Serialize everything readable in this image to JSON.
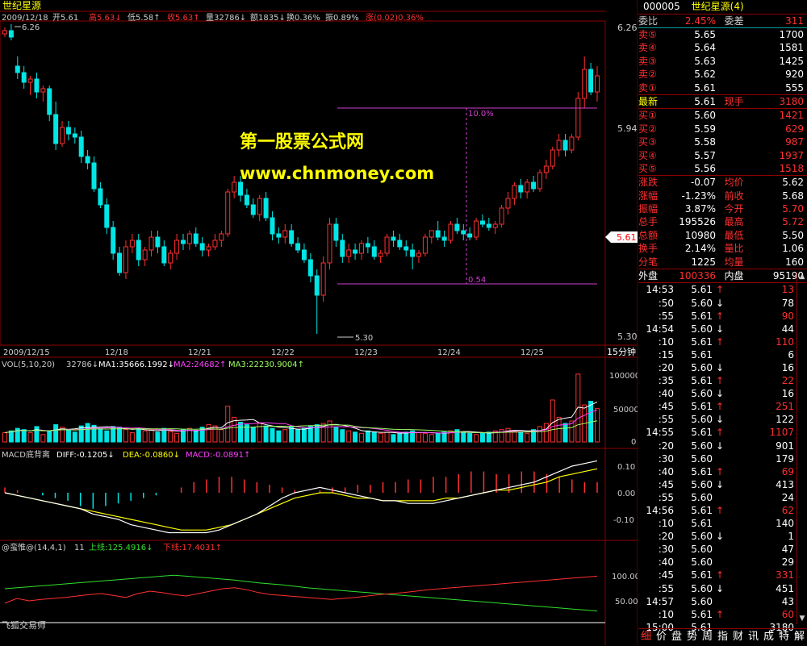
{
  "colors": {
    "up": "#ff3030",
    "down": "#00e5e5",
    "ma1": "#ffffff",
    "ma2": "#ff40ff",
    "ma3": "#a0ff60",
    "grid": "#900000",
    "label": "#cccccc",
    "yellow": "#ffff00",
    "green": "#30e030",
    "ref": "#d040d0"
  },
  "header": {
    "stock_name": "世纪星源",
    "date": "2009/12/18",
    "open": "开5.61",
    "high": "高5.63↓",
    "low": "低5.58↑",
    "close": "收5.63↑",
    "volume": "量32786↓",
    "amount": "额1835↓",
    "turnover": "换0.36%",
    "amplitude": "振0.89%",
    "change": "涨(0.02)0.36%"
  },
  "watermark": {
    "line1": "第一股票公式网",
    "line2": "www.chnmoney.com"
  },
  "main_chart": {
    "price_axis": [
      "6.26",
      "5.94",
      "5.61",
      "5.30"
    ],
    "current_price_tag": "5.61",
    "high_label": "6.26",
    "low_label": "5.30",
    "pct_top": "10.0%",
    "pct_bottom": "0.54",
    "dates": [
      "2009/12/15",
      "12/18",
      "12/21",
      "12/22",
      "12/23",
      "12/24",
      "12/25"
    ],
    "period": "15分钟",
    "candles": [
      [
        6.24,
        6.26,
        6.23,
        6.25
      ],
      [
        6.25,
        6.27,
        6.22,
        6.23
      ],
      [
        6.14,
        6.17,
        6.1,
        6.12
      ],
      [
        6.12,
        6.14,
        6.07,
        6.09
      ],
      [
        6.09,
        6.11,
        6.05,
        6.1
      ],
      [
        6.1,
        6.12,
        6.04,
        6.06
      ],
      [
        6.06,
        6.08,
        6.03,
        6.07
      ],
      [
        6.07,
        6.08,
        5.97,
        5.99
      ],
      [
        5.99,
        6.03,
        5.88,
        5.9
      ],
      [
        5.9,
        5.97,
        5.89,
        5.95
      ],
      [
        5.95,
        5.97,
        5.91,
        5.93
      ],
      [
        5.93,
        5.95,
        5.9,
        5.92
      ],
      [
        5.92,
        5.94,
        5.84,
        5.86
      ],
      [
        5.86,
        5.88,
        5.82,
        5.84
      ],
      [
        5.84,
        5.86,
        5.75,
        5.76
      ],
      [
        5.76,
        5.78,
        5.7,
        5.71
      ],
      [
        5.71,
        5.73,
        5.62,
        5.64
      ],
      [
        5.64,
        5.66,
        5.54,
        5.56
      ],
      [
        5.56,
        5.58,
        5.49,
        5.5
      ],
      [
        5.5,
        5.6,
        5.48,
        5.58
      ],
      [
        5.58,
        5.62,
        5.56,
        5.6
      ],
      [
        5.6,
        5.62,
        5.52,
        5.54
      ],
      [
        5.54,
        5.58,
        5.52,
        5.57
      ],
      [
        5.57,
        5.63,
        5.55,
        5.61
      ],
      [
        5.61,
        5.63,
        5.56,
        5.58
      ],
      [
        5.58,
        5.6,
        5.52,
        5.53
      ],
      [
        5.53,
        5.57,
        5.51,
        5.56
      ],
      [
        5.56,
        5.62,
        5.54,
        5.6
      ],
      [
        5.6,
        5.62,
        5.57,
        5.59
      ],
      [
        5.59,
        5.63,
        5.57,
        5.62
      ],
      [
        5.62,
        5.64,
        5.58,
        5.59
      ],
      [
        5.59,
        5.61,
        5.55,
        5.57
      ],
      [
        5.57,
        5.59,
        5.55,
        5.58
      ],
      [
        5.58,
        5.62,
        5.57,
        5.6
      ],
      [
        5.6,
        5.63,
        5.58,
        5.62
      ],
      [
        5.62,
        5.76,
        5.61,
        5.75
      ],
      [
        5.75,
        5.8,
        5.73,
        5.78
      ],
      [
        5.78,
        5.8,
        5.72,
        5.74
      ],
      [
        5.74,
        5.76,
        5.7,
        5.71
      ],
      [
        5.71,
        5.73,
        5.67,
        5.68
      ],
      [
        5.68,
        5.74,
        5.66,
        5.73
      ],
      [
        5.73,
        5.75,
        5.66,
        5.67
      ],
      [
        5.67,
        5.69,
        5.6,
        5.62
      ],
      [
        5.62,
        5.64,
        5.59,
        5.61
      ],
      [
        5.61,
        5.65,
        5.59,
        5.63
      ],
      [
        5.63,
        5.65,
        5.58,
        5.59
      ],
      [
        5.59,
        5.61,
        5.56,
        5.57
      ],
      [
        5.57,
        5.59,
        5.53,
        5.54
      ],
      [
        5.54,
        5.56,
        5.47,
        5.49
      ],
      [
        5.49,
        5.51,
        5.31,
        5.43
      ],
      [
        5.43,
        5.55,
        5.41,
        5.53
      ],
      [
        5.53,
        5.67,
        5.51,
        5.65
      ],
      [
        5.65,
        5.67,
        5.58,
        5.6
      ],
      [
        5.6,
        5.62,
        5.53,
        5.55
      ],
      [
        5.55,
        5.59,
        5.53,
        5.57
      ],
      [
        5.57,
        5.59,
        5.54,
        5.56
      ],
      [
        5.56,
        5.6,
        5.54,
        5.59
      ],
      [
        5.59,
        5.61,
        5.56,
        5.58
      ],
      [
        5.58,
        5.6,
        5.54,
        5.55
      ],
      [
        5.55,
        5.57,
        5.53,
        5.56
      ],
      [
        5.56,
        5.62,
        5.55,
        5.61
      ],
      [
        5.61,
        5.63,
        5.58,
        5.6
      ],
      [
        5.6,
        5.62,
        5.57,
        5.58
      ],
      [
        5.58,
        5.6,
        5.55,
        5.57
      ],
      [
        5.57,
        5.59,
        5.51,
        5.55
      ],
      [
        5.55,
        5.57,
        5.53,
        5.56
      ],
      [
        5.56,
        5.62,
        5.55,
        5.61
      ],
      [
        5.61,
        5.63,
        5.59,
        5.63
      ],
      [
        5.63,
        5.66,
        5.6,
        5.61
      ],
      [
        5.61,
        5.63,
        5.58,
        5.6
      ],
      [
        5.6,
        5.66,
        5.59,
        5.65
      ],
      [
        5.65,
        5.67,
        5.62,
        5.63
      ],
      [
        5.63,
        5.65,
        5.6,
        5.62
      ],
      [
        5.62,
        5.64,
        5.6,
        5.61
      ],
      [
        5.61,
        5.67,
        5.6,
        5.66
      ],
      [
        5.66,
        5.68,
        5.64,
        5.65
      ],
      [
        5.65,
        5.67,
        5.63,
        5.64
      ],
      [
        5.64,
        5.66,
        5.62,
        5.65
      ],
      [
        5.65,
        5.71,
        5.64,
        5.7
      ],
      [
        5.7,
        5.75,
        5.68,
        5.73
      ],
      [
        5.73,
        5.78,
        5.71,
        5.77
      ],
      [
        5.77,
        5.79,
        5.73,
        5.75
      ],
      [
        5.75,
        5.79,
        5.73,
        5.78
      ],
      [
        5.78,
        5.8,
        5.75,
        5.76
      ],
      [
        5.76,
        5.82,
        5.75,
        5.81
      ],
      [
        5.81,
        5.85,
        5.79,
        5.83
      ],
      [
        5.83,
        5.89,
        5.82,
        5.88
      ],
      [
        5.88,
        5.93,
        5.86,
        5.91
      ],
      [
        5.91,
        5.93,
        5.86,
        5.88
      ],
      [
        5.88,
        5.93,
        5.87,
        5.92
      ],
      [
        5.92,
        6.06,
        5.91,
        6.04
      ],
      [
        6.04,
        6.17,
        6.01,
        6.13
      ],
      [
        6.13,
        6.15,
        6.05,
        6.06
      ],
      [
        6.06,
        6.14,
        6.03,
        6.11
      ]
    ],
    "ma_line": [
      5.65,
      5.65
    ]
  },
  "volume_panel": {
    "label": "VOL(5,10,20)",
    "vol": "32786↓",
    "ma1": "MA1:35666.1992↓",
    "ma2": "MA2:24682↑",
    "ma3": "MA3:22230.9004↑",
    "axis": [
      "100000",
      "50000",
      "0"
    ],
    "values": [
      15000,
      18000,
      22000,
      20000,
      15000,
      25000,
      12000,
      18000,
      28000,
      24000,
      20000,
      16000,
      26000,
      30000,
      27000,
      22000,
      18000,
      25000,
      24000,
      20000,
      15000,
      22000,
      18000,
      20000,
      16000,
      22000,
      17000,
      14000,
      20000,
      22000,
      18000,
      24000,
      28000,
      26000,
      20000,
      58000,
      40000,
      32000,
      28000,
      24000,
      30000,
      26000,
      22000,
      18000,
      20000,
      24000,
      20000,
      22000,
      26000,
      28000,
      30000,
      34000,
      24000,
      20000,
      18000,
      16000,
      14000,
      18000,
      16000,
      14000,
      16000,
      12000,
      14000,
      16000,
      18000,
      15000,
      14000,
      12000,
      14000,
      16000,
      18000,
      20000,
      16000,
      14000,
      12000,
      14000,
      16000,
      18000,
      20000,
      22000,
      18000,
      16000,
      14000,
      20000,
      25000,
      30000,
      68000,
      40000,
      30000,
      34000,
      110000,
      60000,
      66000,
      54000
    ]
  },
  "macd_panel": {
    "label": "MACD底背离",
    "diff": "DIFF:-0.1205↓",
    "dea": "DEA:-0.0860↓",
    "macd": "MACD:-0.0891↑",
    "axis": [
      "0.10",
      "0.00",
      "-0.10"
    ],
    "diff_values": [
      0.0,
      -0.01,
      -0.02,
      -0.03,
      -0.04,
      -0.05,
      -0.06,
      -0.08,
      -0.09,
      -0.1,
      -0.12,
      -0.13,
      -0.14,
      -0.15,
      -0.15,
      -0.15,
      -0.15,
      -0.14,
      -0.12,
      -0.1,
      -0.08,
      -0.05,
      -0.02,
      0.0,
      0.01,
      0.02,
      0.01,
      0.0,
      -0.01,
      -0.02,
      -0.03,
      -0.03,
      -0.04,
      -0.04,
      -0.04,
      -0.03,
      -0.02,
      -0.01,
      0.0,
      0.01,
      0.02,
      0.03,
      0.04,
      0.06,
      0.08,
      0.1,
      0.11,
      0.12
    ],
    "dea_values": [
      0.0,
      -0.01,
      -0.02,
      -0.03,
      -0.04,
      -0.05,
      -0.06,
      -0.07,
      -0.08,
      -0.09,
      -0.1,
      -0.11,
      -0.12,
      -0.13,
      -0.14,
      -0.14,
      -0.14,
      -0.13,
      -0.12,
      -0.1,
      -0.08,
      -0.06,
      -0.04,
      -0.02,
      -0.01,
      0.0,
      0.0,
      -0.01,
      -0.02,
      -0.02,
      -0.03,
      -0.03,
      -0.03,
      -0.03,
      -0.03,
      -0.02,
      -0.02,
      -0.01,
      0.0,
      0.01,
      0.01,
      0.02,
      0.03,
      0.04,
      0.06,
      0.07,
      0.08,
      0.09
    ],
    "hist_values": [
      0.02,
      0.01,
      0.0,
      -0.01,
      -0.02,
      -0.03,
      -0.05,
      -0.06,
      -0.05,
      -0.04,
      -0.03,
      -0.02,
      -0.01,
      0.0,
      0.02,
      0.04,
      0.05,
      0.06,
      0.06,
      0.05,
      0.04,
      0.03,
      0.02,
      0.01,
      0.0,
      0.01,
      0.02,
      0.02,
      0.03,
      0.03,
      0.04,
      0.04,
      0.05,
      0.05,
      0.06,
      0.06,
      0.07,
      0.08,
      0.08,
      0.07,
      0.07,
      0.08,
      0.08,
      0.07,
      0.06,
      0.05,
      0.04,
      0.04
    ]
  },
  "kdj_panel": {
    "label": "@蛮惟@(14,4,1)",
    "value": "11",
    "upper": "上线:125.4916↓",
    "lower": "下线:17.4031↑",
    "axis": [
      "100.00",
      "50.00"
    ],
    "upper_values": [
      70,
      72,
      74,
      76,
      78,
      80,
      82,
      84,
      86,
      88,
      90,
      92,
      94,
      96,
      98,
      96,
      94,
      92,
      90,
      88,
      85,
      82,
      80,
      78,
      75,
      72,
      70,
      68,
      66,
      64,
      62,
      60,
      58,
      56,
      54,
      52,
      50,
      48,
      46,
      44,
      42,
      40,
      38,
      36,
      34,
      32,
      30,
      28,
      26,
      24
    ],
    "lower_values": [
      40,
      50,
      45,
      48,
      50,
      52,
      55,
      58,
      60,
      56,
      52,
      60,
      65,
      62,
      58,
      55,
      60,
      65,
      70,
      72,
      68,
      62,
      58,
      56,
      54,
      52,
      50,
      48,
      50,
      52,
      55,
      58,
      60,
      62,
      65,
      68,
      70,
      72,
      74,
      76,
      78,
      80,
      82,
      84,
      86,
      88,
      90,
      92,
      94,
      96
    ],
    "footer": "飞狐交易师"
  },
  "quote": {
    "code": "000005",
    "name": "世纪星源(4)",
    "weibi": {
      "label": "委比",
      "value": "2.45%",
      "label2": "委差",
      "value2": "311"
    },
    "asks": [
      {
        "label": "卖⑤",
        "price": "5.65",
        "vol": "1700"
      },
      {
        "label": "卖④",
        "price": "5.64",
        "vol": "1581"
      },
      {
        "label": "卖③",
        "price": "5.63",
        "vol": "1425"
      },
      {
        "label": "卖②",
        "price": "5.62",
        "vol": "920"
      },
      {
        "label": "卖①",
        "price": "5.61",
        "vol": "555"
      }
    ],
    "latest": {
      "label": "最新",
      "price": "5.61",
      "label2": "现手",
      "vol": "3180"
    },
    "bids": [
      {
        "label": "买①",
        "price": "5.60",
        "vol": "1421"
      },
      {
        "label": "买②",
        "price": "5.59",
        "vol": "629"
      },
      {
        "label": "买③",
        "price": "5.58",
        "vol": "987"
      },
      {
        "label": "买④",
        "price": "5.57",
        "vol": "1937"
      },
      {
        "label": "买⑤",
        "price": "5.56",
        "vol": "1518"
      }
    ],
    "stats": [
      {
        "l1": "涨跌",
        "v1": "-0.07",
        "l2": "均价",
        "v2": "5.62",
        "c2": "#ffffff"
      },
      {
        "l1": "涨幅",
        "v1": "-1.23%",
        "l2": "前收",
        "v2": "5.68",
        "c2": "#ffffff"
      },
      {
        "l1": "振幅",
        "v1": "3.87%",
        "l2": "今开",
        "v2": "5.70",
        "c2": "#ff3030"
      },
      {
        "l1": "总手",
        "v1": "195526",
        "l2": "最高",
        "v2": "5.72",
        "c2": "#ff3030"
      },
      {
        "l1": "总额",
        "v1": "10980",
        "l2": "最低",
        "v2": "5.50",
        "c2": "#ffffff"
      },
      {
        "l1": "换手",
        "v1": "2.14%",
        "l2": "量比",
        "v2": "1.06",
        "c2": "#ffffff"
      },
      {
        "l1": "分笔",
        "v1": "1225",
        "l2": "均量",
        "v2": "160",
        "c2": "#ffffff"
      }
    ],
    "outer": {
      "label": "外盘",
      "value": "100336",
      "label2": "内盘",
      "value2": "95190"
    },
    "ticks": [
      {
        "t": "14:53",
        "p": "5.61",
        "d": "up",
        "v": "13"
      },
      {
        "t": ":50",
        "p": "5.60",
        "d": "down",
        "v": "78"
      },
      {
        "t": ":55",
        "p": "5.61",
        "d": "up",
        "v": "90"
      },
      {
        "t": "14:54",
        "p": "5.60",
        "d": "down",
        "v": "44"
      },
      {
        "t": ":10",
        "p": "5.61",
        "d": "up",
        "v": "110"
      },
      {
        "t": ":15",
        "p": "5.61",
        "d": "",
        "v": "6"
      },
      {
        "t": ":20",
        "p": "5.60",
        "d": "down",
        "v": "16"
      },
      {
        "t": ":35",
        "p": "5.61",
        "d": "up",
        "v": "22"
      },
      {
        "t": ":40",
        "p": "5.60",
        "d": "down",
        "v": "16"
      },
      {
        "t": ":45",
        "p": "5.61",
        "d": "up",
        "v": "251"
      },
      {
        "t": ":55",
        "p": "5.60",
        "d": "down",
        "v": "122"
      },
      {
        "t": "14:55",
        "p": "5.61",
        "d": "up",
        "v": "1107"
      },
      {
        "t": ":20",
        "p": "5.60",
        "d": "down",
        "v": "901"
      },
      {
        "t": ":30",
        "p": "5.60",
        "d": "",
        "v": "179"
      },
      {
        "t": ":40",
        "p": "5.61",
        "d": "up",
        "v": "69"
      },
      {
        "t": ":45",
        "p": "5.60",
        "d": "down",
        "v": "413"
      },
      {
        "t": ":55",
        "p": "5.60",
        "d": "",
        "v": "24"
      },
      {
        "t": "14:56",
        "p": "5.61",
        "d": "up",
        "v": "62"
      },
      {
        "t": ":10",
        "p": "5.61",
        "d": "",
        "v": "140"
      },
      {
        "t": ":20",
        "p": "5.60",
        "d": "down",
        "v": "1"
      },
      {
        "t": ":30",
        "p": "5.60",
        "d": "",
        "v": "47"
      },
      {
        "t": ":40",
        "p": "5.60",
        "d": "",
        "v": "29"
      },
      {
        "t": ":45",
        "p": "5.61",
        "d": "up",
        "v": "331"
      },
      {
        "t": ":55",
        "p": "5.60",
        "d": "down",
        "v": "451"
      },
      {
        "t": "14:57",
        "p": "5.60",
        "d": "",
        "v": "43"
      },
      {
        "t": ":10",
        "p": "5.61",
        "d": "up",
        "v": "60"
      },
      {
        "t": "15:00",
        "p": "5.61",
        "d": "",
        "v": "3180"
      }
    ],
    "bottom_tabs": [
      "细",
      "价",
      "盘",
      "势",
      "周",
      "指",
      "财",
      "讯",
      "成",
      "特",
      "解"
    ]
  }
}
